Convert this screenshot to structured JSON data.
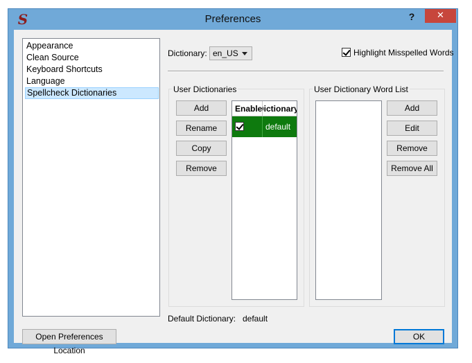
{
  "window": {
    "title": "Preferences",
    "help_label": "?",
    "close_label": "✕",
    "app_icon_glyph": "S"
  },
  "sidebar": {
    "items": [
      {
        "label": "Appearance"
      },
      {
        "label": "Clean Source"
      },
      {
        "label": "Keyboard Shortcuts"
      },
      {
        "label": "Language"
      },
      {
        "label": "Spellcheck Dictionaries",
        "selected": true
      }
    ]
  },
  "dictionary": {
    "label": "Dictionary:",
    "selected": "en_US"
  },
  "highlight": {
    "label": "Highlight Misspelled Words",
    "checked": true
  },
  "user_dictionaries": {
    "title": "User Dictionaries",
    "buttons": {
      "add": "Add",
      "rename": "Rename",
      "copy": "Copy",
      "remove": "Remove"
    },
    "columns": [
      "Enable",
      "Dictionary"
    ],
    "rows": [
      {
        "enabled": true,
        "name": "default"
      }
    ]
  },
  "word_list": {
    "title": "User Dictionary Word List",
    "buttons": {
      "add": "Add",
      "edit": "Edit",
      "remove": "Remove",
      "remove_all": "Remove All"
    }
  },
  "default_dictionary": {
    "label": "Default Dictionary:",
    "value": "default"
  },
  "footer": {
    "open_location": "Open Preferences Location",
    "ok": "OK"
  },
  "colors": {
    "titlebar": "#70a9d8",
    "close": "#c7463c",
    "selected_row": "#0e7a0e",
    "selection": "#cce8ff"
  }
}
